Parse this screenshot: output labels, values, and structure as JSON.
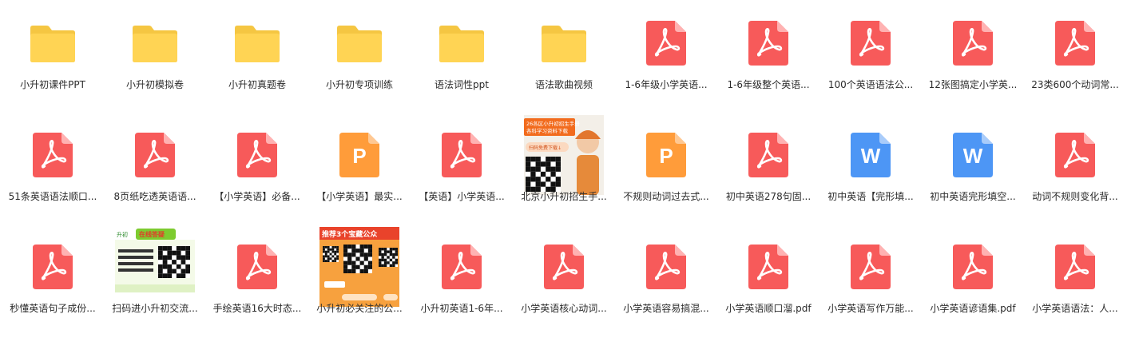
{
  "colors": {
    "folder": "#FFD454",
    "folder_dark": "#F5C642",
    "pdf": "#F75A5A",
    "pdf_fold": "#FFB2B2",
    "ppt": "#FF9C3A",
    "ppt_fold": "#FFC892",
    "word": "#4D96F5",
    "word_fold": "#A9CCFA",
    "label_text": "#2B2B2B"
  },
  "files": [
    {
      "type": "folder",
      "icon": "folder-icon",
      "name": "小升初课件PPT"
    },
    {
      "type": "folder",
      "icon": "folder-icon",
      "name": "小升初模拟卷"
    },
    {
      "type": "folder",
      "icon": "folder-icon",
      "name": "小升初真题卷"
    },
    {
      "type": "folder",
      "icon": "folder-icon",
      "name": "小升初专项训练"
    },
    {
      "type": "folder",
      "icon": "folder-icon",
      "name": "语法词性ppt"
    },
    {
      "type": "folder",
      "icon": "folder-icon",
      "name": "语法歌曲视频"
    },
    {
      "type": "pdf",
      "icon": "pdf-icon",
      "name": "1-6年级小学英语..."
    },
    {
      "type": "pdf",
      "icon": "pdf-icon",
      "name": "1-6年级整个英语..."
    },
    {
      "type": "pdf",
      "icon": "pdf-icon",
      "name": "100个英语语法公..."
    },
    {
      "type": "pdf",
      "icon": "pdf-icon",
      "name": "12张图搞定小学英..."
    },
    {
      "type": "pdf",
      "icon": "pdf-icon",
      "name": "23类600个动词常..."
    },
    {
      "type": "pdf",
      "icon": "pdf-icon",
      "name": "51条英语语法顺口..."
    },
    {
      "type": "pdf",
      "icon": "pdf-icon",
      "name": "8页纸吃透英语语..."
    },
    {
      "type": "pdf",
      "icon": "pdf-icon",
      "name": "【小学英语】必备..."
    },
    {
      "type": "ppt",
      "icon": "ppt-icon",
      "name": "【小学英语】最实...",
      "letter": "P"
    },
    {
      "type": "pdf",
      "icon": "pdf-icon",
      "name": "【英语】小学英语..."
    },
    {
      "type": "image",
      "icon": "image-thumbnail",
      "name": "北京小升初招生手...",
      "thumb": "qr1",
      "thumb_text": "26各区小升初招生手册 各科学习资料下载",
      "thumb_sub": "扫码免费下载↓"
    },
    {
      "type": "ppt",
      "icon": "ppt-icon",
      "name": "不规则动词过去式...",
      "letter": "P"
    },
    {
      "type": "pdf",
      "icon": "pdf-icon",
      "name": "初中英语278句固..."
    },
    {
      "type": "word",
      "icon": "word-icon",
      "name": "初中英语【完形填...",
      "letter": "W"
    },
    {
      "type": "word",
      "icon": "word-icon",
      "name": "初中英语完形填空...",
      "letter": "W"
    },
    {
      "type": "pdf",
      "icon": "pdf-icon",
      "name": "动词不规则变化背..."
    },
    {
      "type": "pdf",
      "icon": "pdf-icon",
      "name": "秒懂英语句子成份..."
    },
    {
      "type": "image",
      "icon": "image-thumbnail",
      "name": "扫码进小升初交流...",
      "thumb": "qr2",
      "thumb_text": "在线答疑"
    },
    {
      "type": "pdf",
      "icon": "pdf-icon",
      "name": "手绘英语16大时态..."
    },
    {
      "type": "image",
      "icon": "image-thumbnail",
      "name": "小升初必关注的公...",
      "thumb": "qr3",
      "thumb_text": "推荐3个宝藏公众"
    },
    {
      "type": "pdf",
      "icon": "pdf-icon",
      "name": "小升初英语1-6年..."
    },
    {
      "type": "pdf",
      "icon": "pdf-icon",
      "name": "小学英语核心动词..."
    },
    {
      "type": "pdf",
      "icon": "pdf-icon",
      "name": "小学英语容易搞混..."
    },
    {
      "type": "pdf",
      "icon": "pdf-icon",
      "name": "小学英语顺口溜.pdf"
    },
    {
      "type": "pdf",
      "icon": "pdf-icon",
      "name": "小学英语写作万能..."
    },
    {
      "type": "pdf",
      "icon": "pdf-icon",
      "name": "小学英语谚语集.pdf"
    },
    {
      "type": "pdf",
      "icon": "pdf-icon",
      "name": "小学英语语法：人..."
    }
  ]
}
